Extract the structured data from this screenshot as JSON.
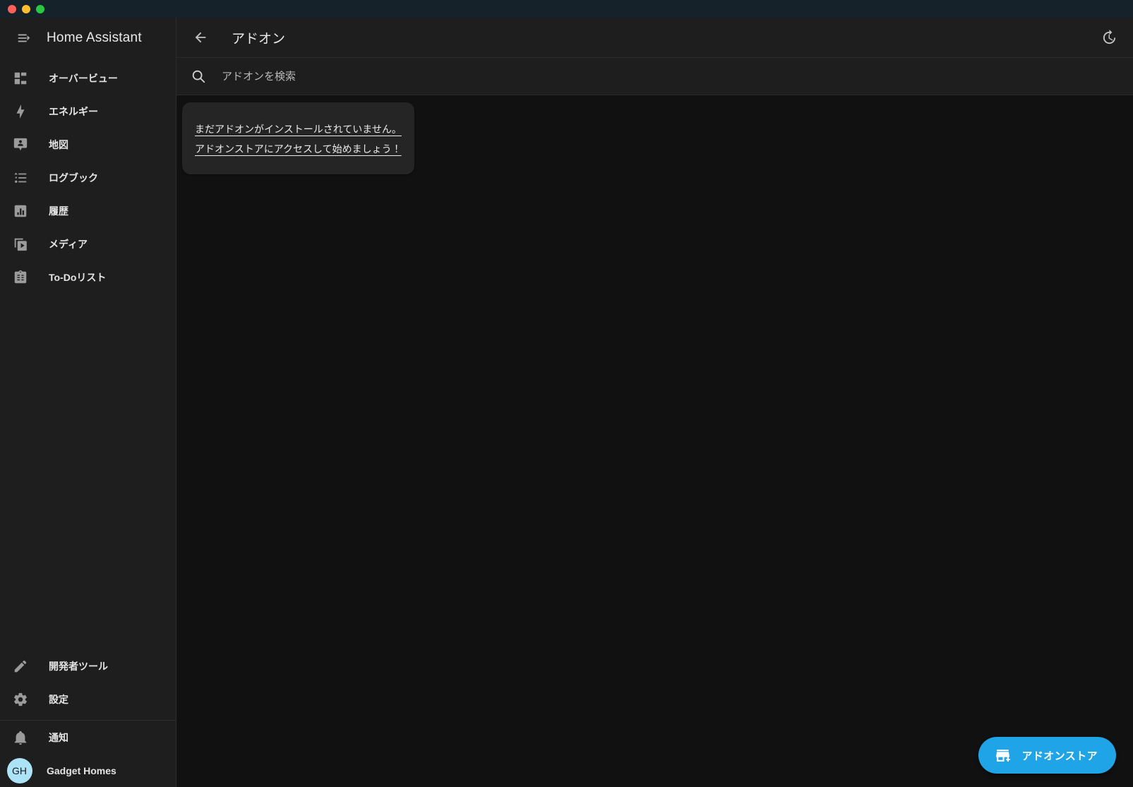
{
  "window": {
    "traffic_lights": [
      "close",
      "minimize",
      "maximize"
    ],
    "colors": {
      "titlebar_bg": "#16222a",
      "sidebar_bg": "#1e1e1e",
      "main_bg": "#111111",
      "card_bg": "#252525",
      "accent": "#1fa4e8",
      "avatar_bg": "#ace3f7"
    }
  },
  "sidebar": {
    "menu_icon": "menu-open-icon",
    "title": "Home Assistant",
    "items": [
      {
        "label": "オーバービュー",
        "icon": "view-dashboard-icon",
        "name": "overview"
      },
      {
        "label": "エネルギー",
        "icon": "lightning-bolt-icon",
        "name": "energy"
      },
      {
        "label": "地図",
        "icon": "map-marker-account-icon",
        "name": "map"
      },
      {
        "label": "ログブック",
        "icon": "format-list-bulleted-icon",
        "name": "logbook"
      },
      {
        "label": "履歴",
        "icon": "chart-box-icon",
        "name": "history"
      },
      {
        "label": "メディア",
        "icon": "play-box-multiple-icon",
        "name": "media"
      },
      {
        "label": "To-Doリスト",
        "icon": "clipboard-list-icon",
        "name": "todo"
      }
    ],
    "bottom_items": [
      {
        "label": "開発者ツール",
        "icon": "hammer-icon",
        "name": "developer-tools"
      },
      {
        "label": "設定",
        "icon": "cog-icon",
        "name": "settings"
      }
    ],
    "footer_items": [
      {
        "label": "通知",
        "icon": "bell-icon",
        "name": "notifications"
      }
    ],
    "profile": {
      "initials": "GH",
      "label": "Gadget Homes"
    }
  },
  "toolbar": {
    "back_icon": "arrow-left-icon",
    "title": "アドオン",
    "refresh_icon": "clock-refresh-icon"
  },
  "search": {
    "icon": "search-icon",
    "value": "",
    "placeholder": "アドオンを検索"
  },
  "content": {
    "empty_state": {
      "line1": "まだアドオンがインストールされていません。",
      "line2": "アドオンストアにアクセスして始めましょう！"
    }
  },
  "fab": {
    "icon": "store-plus-icon",
    "label": "アドオンストア"
  }
}
